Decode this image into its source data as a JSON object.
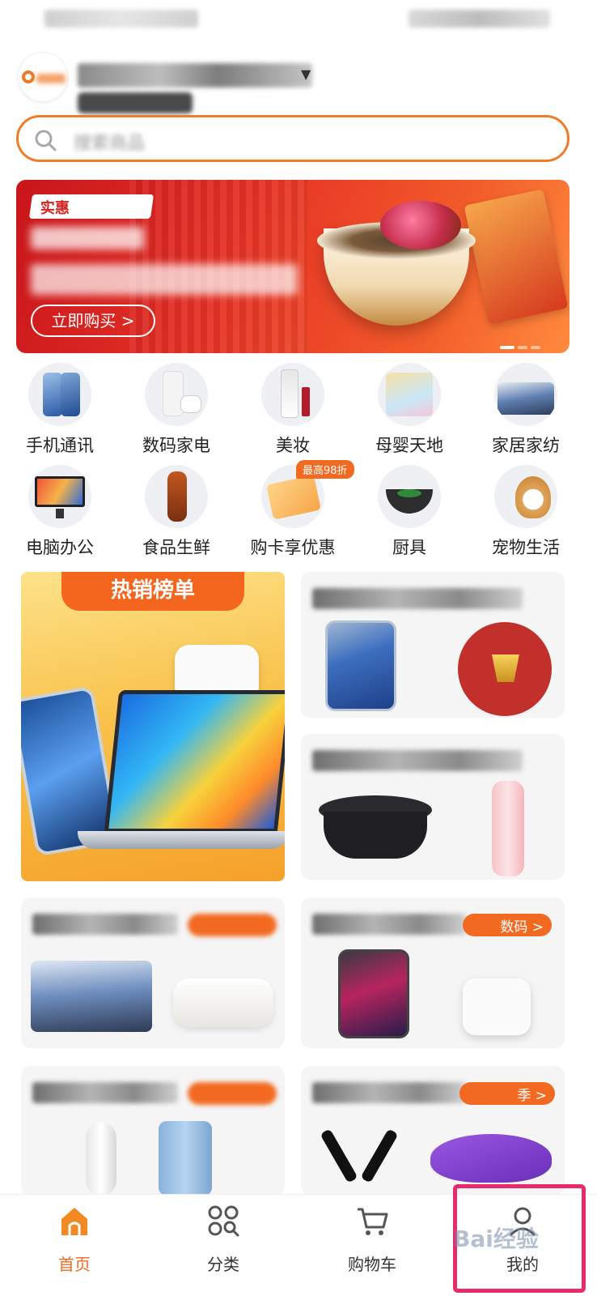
{
  "search": {
    "placeholder": "搜索商品"
  },
  "banner": {
    "tag": "实惠",
    "buy_button": "立即购买 >"
  },
  "categories": [
    {
      "label": "手机通讯"
    },
    {
      "label": "数码家电"
    },
    {
      "label": "美妆"
    },
    {
      "label": "母婴天地"
    },
    {
      "label": "家居家纺"
    },
    {
      "label": "电脑办公"
    },
    {
      "label": "食品生鲜"
    },
    {
      "label": "购卡享优惠",
      "badge": "最高98折"
    },
    {
      "label": "厨具"
    },
    {
      "label": "宠物生活"
    }
  ],
  "promos": {
    "hot_title": "热销榜单",
    "tag_digital": "数码 >",
    "tag_season": "季 >"
  },
  "nav": {
    "home": "首页",
    "category": "分类",
    "cart": "购物车",
    "mine": "我的"
  },
  "watermark": "Bai经验",
  "colors": {
    "accent": "#f26a21",
    "highlight": "#e8296a"
  }
}
